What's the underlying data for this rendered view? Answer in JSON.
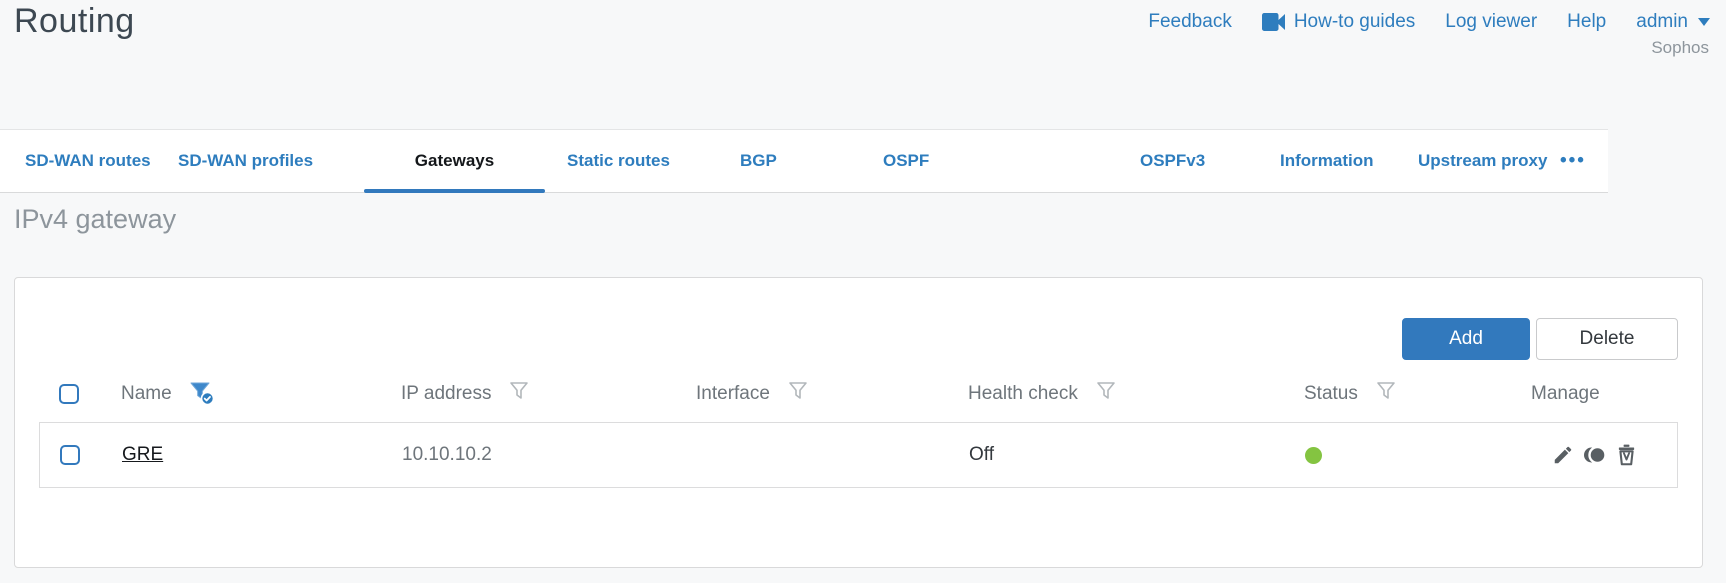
{
  "header": {
    "title": "Routing",
    "brand": "Sophos",
    "nav": {
      "feedback": "Feedback",
      "howto_guides": "How-to guides",
      "log_viewer": "Log viewer",
      "help": "Help",
      "user": "admin"
    }
  },
  "tabs": {
    "items": [
      {
        "label": "SD-WAN routes",
        "active": false
      },
      {
        "label": "SD-WAN profiles",
        "active": false
      },
      {
        "label": "Gateways",
        "active": true
      },
      {
        "label": "Static routes",
        "active": false
      },
      {
        "label": "BGP",
        "active": false
      },
      {
        "label": "OSPF",
        "active": false
      },
      {
        "label": "OSPFv3",
        "active": false
      },
      {
        "label": "Information",
        "active": false
      },
      {
        "label": "Upstream proxy",
        "active": false
      },
      {
        "label": "•••",
        "active": false
      }
    ]
  },
  "content": {
    "heading": "IPv4 gateway",
    "toolbar": {
      "add": "Add",
      "delete": "Delete"
    },
    "table": {
      "columns": [
        {
          "label": "Name",
          "filter": "active"
        },
        {
          "label": "IP address",
          "filter": "default"
        },
        {
          "label": "Interface",
          "filter": "default"
        },
        {
          "label": "Health check",
          "filter": "default"
        },
        {
          "label": "Status",
          "filter": "default"
        },
        {
          "label": "Manage",
          "filter": null
        }
      ],
      "rows": [
        {
          "name": "GRE",
          "ip_address": "10.10.10.2",
          "interface": "",
          "health_check": "Off",
          "status": "up",
          "status_color": "#84c441",
          "actions": [
            "edit",
            "clone",
            "delete"
          ]
        }
      ]
    }
  },
  "colors": {
    "accent_blue": "#3279bd",
    "link_blue": "#2e7dbe",
    "status_green": "#84c441",
    "heading_gray": "#8d959c"
  }
}
